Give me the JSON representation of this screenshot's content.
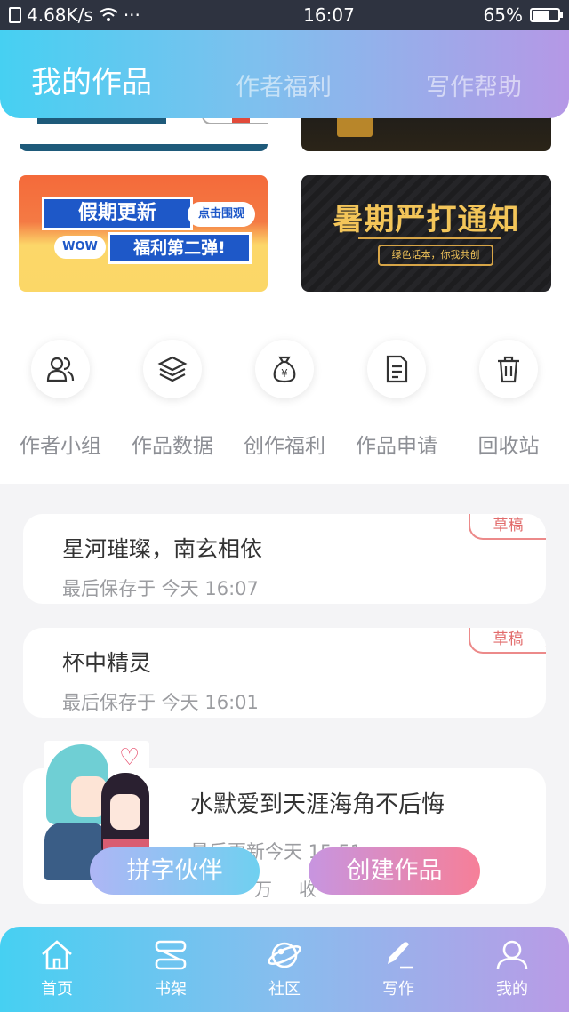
{
  "status_bar": {
    "speed": "4.68K/s",
    "time": "16:07",
    "battery": "65%",
    "battery_level": 0.65
  },
  "header": {
    "tabs": [
      "我的作品",
      "作者福利",
      "写作帮助"
    ],
    "active_tab": 0
  },
  "banners": [
    {
      "title": "假期更新",
      "pill": "点击围观",
      "badge": "WOW",
      "subtitle": "福利第二弹!"
    },
    {
      "title": "暑期严打通知",
      "subtitle": "绿色话本，你我共创"
    }
  ],
  "shortcuts": [
    {
      "label": "作者小组",
      "icon": "people-icon"
    },
    {
      "label": "作品数据",
      "icon": "layers-icon"
    },
    {
      "label": "创作福利",
      "icon": "money-bag-icon"
    },
    {
      "label": "作品申请",
      "icon": "document-icon"
    },
    {
      "label": "回收站",
      "icon": "trash-icon"
    }
  ],
  "drafts": [
    {
      "title": "星河璀璨，南玄相依",
      "meta": "最后保存于 今天 16:07",
      "badge": "草稿"
    },
    {
      "title": "杯中精灵",
      "meta": "最后保存于 今天 16:01",
      "badge": "草稿"
    }
  ],
  "published": {
    "title": "水默爱到天涯海角不后悔",
    "meta": "最后更新今天 15:51",
    "stat1": "万",
    "stat2": "收"
  },
  "actions": {
    "partner": "拼字伙伴",
    "create": "创建作品"
  },
  "nav": [
    {
      "label": "首页",
      "icon": "home-icon"
    },
    {
      "label": "书架",
      "icon": "bookshelf-icon"
    },
    {
      "label": "社区",
      "icon": "planet-icon"
    },
    {
      "label": "写作",
      "icon": "pen-icon",
      "active": true
    },
    {
      "label": "我的",
      "icon": "user-icon"
    }
  ],
  "colors": {
    "header_start": "#46d0f2",
    "header_end": "#b598e6",
    "badge": "#e26b6b",
    "create_button": "#f67f98"
  }
}
